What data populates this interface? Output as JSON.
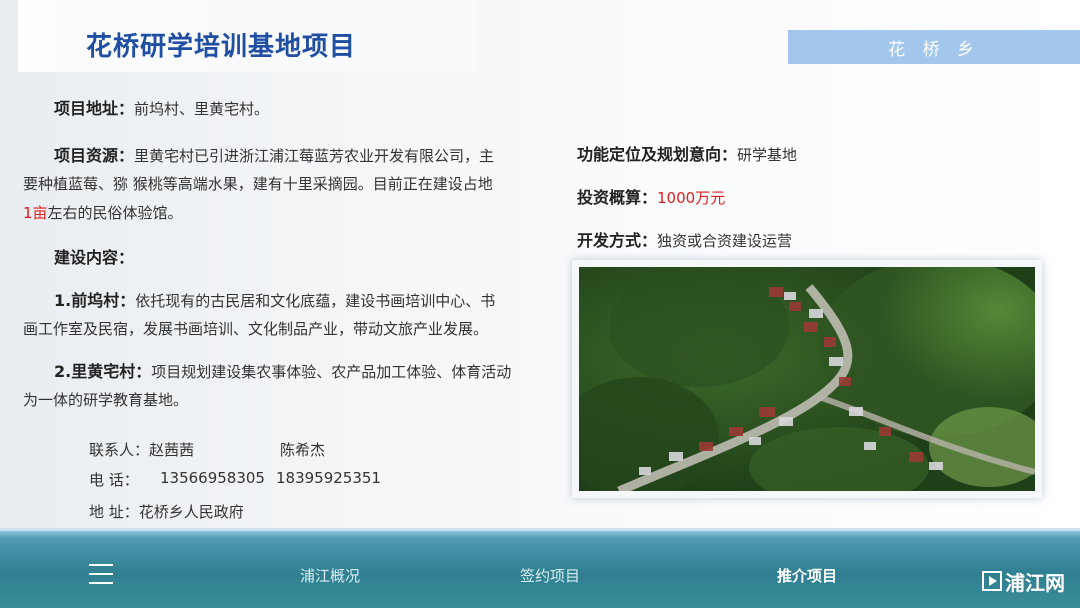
{
  "header": {
    "title": "花桥研学培训基地项目",
    "region": "花 桥 乡"
  },
  "left": {
    "address_label": "项目地址：",
    "address_value": "前坞村、里黄宅村。",
    "resource_label": "项目资源：",
    "resource_line1": "里黄宅村已引进浙江浦江莓蓝芳农业开发有限公司，主",
    "resource_line2": "要种植蓝莓、猕 猴桃等高端水果，建有十里采摘园。目前正在建设占地",
    "resource_line3_red": "1亩",
    "resource_line3_rest": "左右的民俗体验馆。",
    "content_label": "建设内容：",
    "item1_label": "1.前坞村：",
    "item1_line1": "依托现有的古民居和文化底蕴，建设书画培训中心、书",
    "item1_line2": "画工作室及民宿，发展书画培训、文化制品产业，带动文旅产业发展。",
    "item2_label": "2.里黄宅村：",
    "item2_line1": "项目规划建设集农事体验、农产品加工体验、体育活动",
    "item2_line2": "为一体的研学教育基地。"
  },
  "contact": {
    "person_label": "联系人：赵茜茜",
    "person2": "陈希杰",
    "phone_label": "电    话：",
    "phone1": "13566958305",
    "phone2": "18395925351",
    "addr": "地    址：花桥乡人民政府"
  },
  "right": {
    "function_label": "功能定位及规划意向：",
    "function_value": "研学基地",
    "invest_label": "投资概算：",
    "invest_value": "1000万元",
    "mode_label": "开发方式：",
    "mode_value": "独资或合资建设运营"
  },
  "nav": {
    "item1": "浦江概况",
    "item2": "签约项目",
    "item3": "推介项目",
    "logo_text": "浦江网"
  },
  "colors": {
    "title": "#1f4ea3",
    "accent_red": "#e02020",
    "tag_bg": "#a3c7ec"
  }
}
